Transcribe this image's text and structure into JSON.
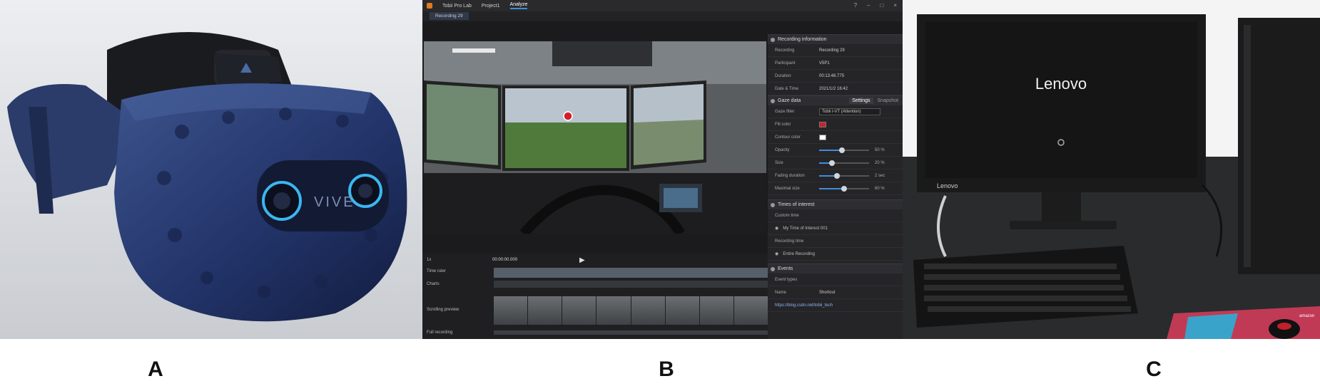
{
  "captions": {
    "a": "A",
    "b": "B",
    "c": "C"
  },
  "panel_a": {
    "headset_brand": "VIVE"
  },
  "panel_b": {
    "titlebar": {
      "app": "Tobii Pro Lab",
      "project": "Project1",
      "analyze_tab": "Analyze"
    },
    "recording_tab": "Recording 29",
    "recording_information": {
      "title": "Recording information",
      "rows": [
        {
          "key": "Recording",
          "value": "Recording 29"
        },
        {
          "key": "Participant",
          "value": "V5P1"
        },
        {
          "key": "Duration",
          "value": "00:13:48.775"
        },
        {
          "key": "Date & Time",
          "value": "2021/1/2 16:42"
        }
      ]
    },
    "gaze_data": {
      "title": "Gaze data",
      "tab_settings": "Settings",
      "tab_snapshot": "Snapshot",
      "rows": [
        {
          "key": "Gaze filter",
          "value": "Tobii I-VT (Attention)"
        },
        {
          "key": "Fill color",
          "value": ""
        },
        {
          "key": "Contour color",
          "value": ""
        }
      ],
      "sliders": [
        {
          "key": "Opacity",
          "value": 0.45,
          "label": "50 %"
        },
        {
          "key": "Size",
          "value": 0.25,
          "label": "20 %"
        },
        {
          "key": "Fading duration",
          "value": 0.35,
          "label": "2 sec"
        },
        {
          "key": "Maximal size",
          "value": 0.5,
          "label": "60 %"
        }
      ],
      "fill_color": "#d0202a",
      "contour_color": "#ffffff"
    },
    "times_of_interest": {
      "title": "Times of interest",
      "custom_label": "Custom time",
      "custom_item": "My Time of Interest 001",
      "recording_label": "Recording time",
      "recording_item": "Entire Recording"
    },
    "events": {
      "title": "Events",
      "event_types": "Event types",
      "name_key": "Name",
      "name_value": "Shortcut",
      "url": "https://blog.csdn.net/tobii_tech"
    },
    "player": {
      "time": "00:00:00.000",
      "speed": "1x"
    },
    "timeline_labels": [
      "Time ruler",
      "Charts",
      "Scrolling preview",
      "Full recording"
    ]
  },
  "panel_c": {
    "monitor_brand": "Lenovo",
    "bezel_brand": "Lenovo",
    "sticker": "amazon"
  },
  "colors": {
    "headset_blue": "#1e2d55",
    "vive_ring": "#3ab7f0",
    "tobii_accent": "#3e8edb",
    "screen_black": "#151515"
  }
}
